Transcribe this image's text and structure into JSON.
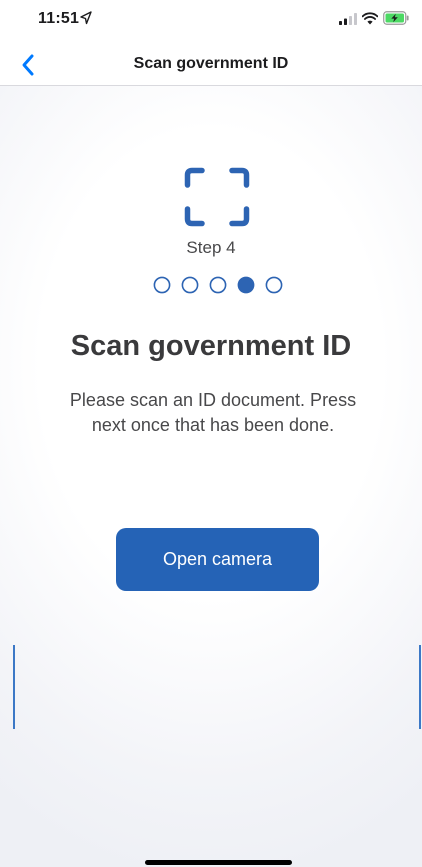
{
  "status_bar": {
    "time": "11:51",
    "icons": [
      "location-arrow-icon",
      "signal-icon",
      "wifi-icon",
      "battery-charging-icon"
    ]
  },
  "nav": {
    "back_icon": "chevron-left-icon",
    "title": "Scan government ID"
  },
  "content": {
    "icon": "scan-frame-icon",
    "step_label": "Step 4",
    "steps_total": 5,
    "current_step": 4,
    "heading": "Scan government ID",
    "instructions": "Please scan an ID document. Press next once that has been done.",
    "button_label": "Open camera"
  },
  "colors": {
    "accent": "#2563b6",
    "ios_blue": "#007aff",
    "battery_green": "#4cd964"
  }
}
